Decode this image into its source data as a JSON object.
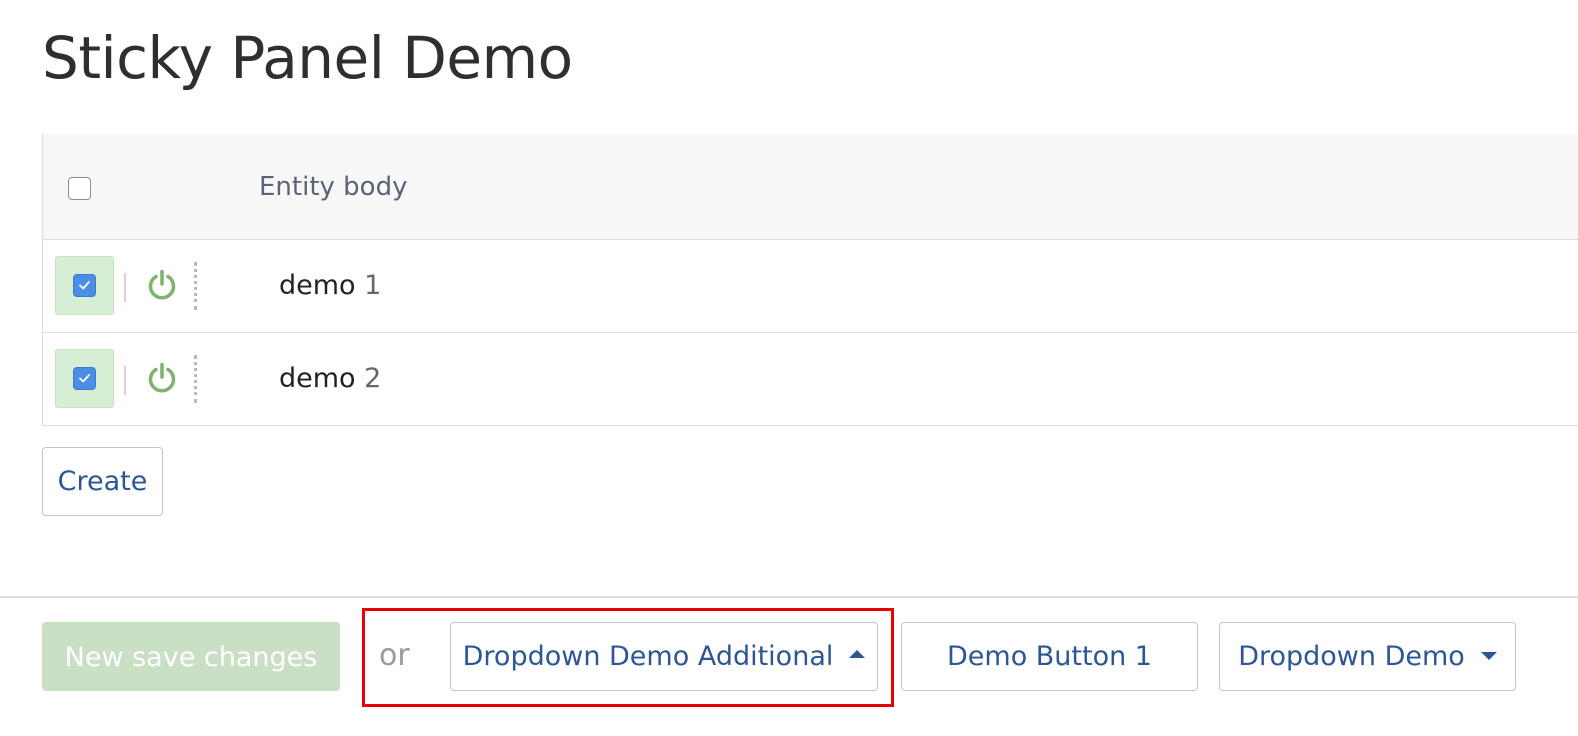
{
  "page": {
    "title": "Sticky Panel Demo"
  },
  "grid": {
    "columns": [
      {
        "label": "Entity body"
      }
    ],
    "rows": [
      {
        "word": "demo",
        "number": "1",
        "selected": true,
        "enabled": true
      },
      {
        "word": "demo",
        "number": "2",
        "selected": true,
        "enabled": true
      }
    ]
  },
  "actions": {
    "create_label": "Create"
  },
  "footer": {
    "save_label": "New save changes",
    "or_label": "or",
    "dropdown_additional_label": "Dropdown Demo Additional",
    "demo_button_1_label": "Demo Button 1",
    "dropdown_demo_label": "Dropdown Demo"
  },
  "icons": {
    "row_toggle": "power-icon",
    "row_drag": "drag-handle-icon",
    "dropdown_up": "caret-up-icon",
    "dropdown_down": "caret-down-icon"
  },
  "colors": {
    "enabled_green": "#7cb36d",
    "link_blue": "#2d5693",
    "save_disabled_bg": "#c9e0c5",
    "selected_row_bg": "#d6efd4",
    "highlight_red": "#e60000"
  }
}
